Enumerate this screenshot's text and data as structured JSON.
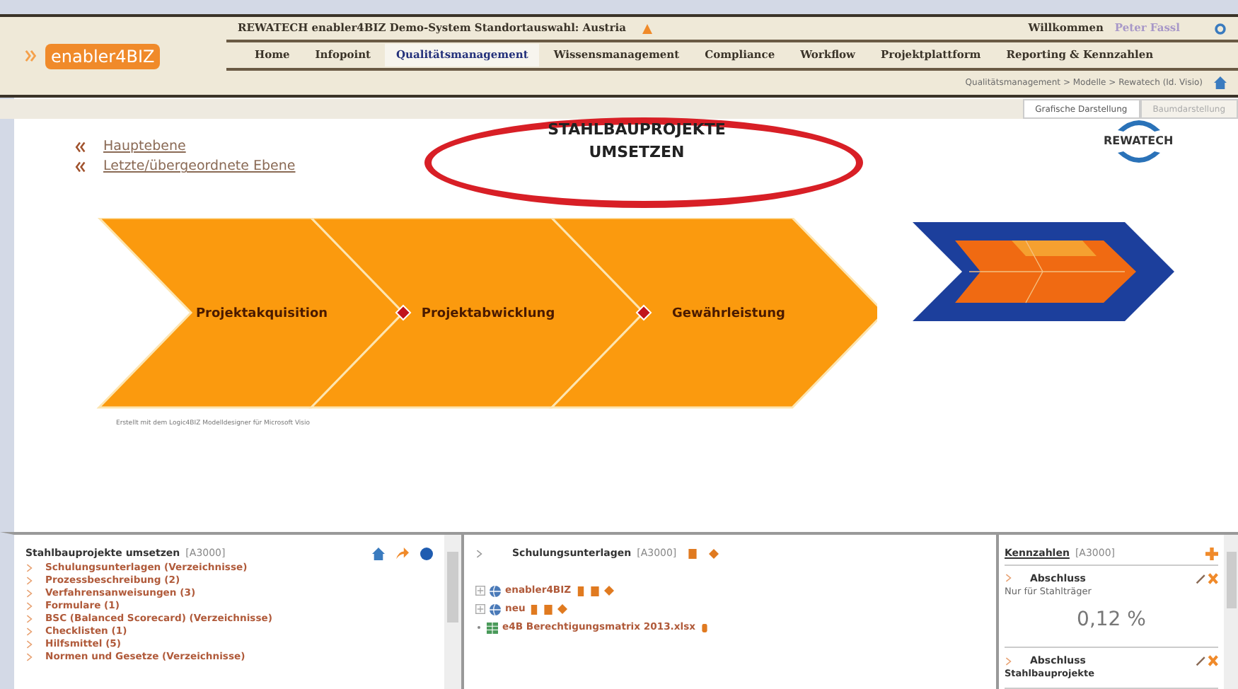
{
  "app_logo": "enabler4BIZ",
  "header": {
    "title": "REWATECH enabler4BIZ Demo-System Standortauswahl: Austria",
    "welcome": "Willkommen",
    "user": "Peter Fassl"
  },
  "nav": [
    {
      "label": "Home",
      "selected": false
    },
    {
      "label": "Infopoint",
      "selected": false
    },
    {
      "label": "Qualitätsmanagement",
      "selected": true
    },
    {
      "label": "Wissensmanagement",
      "selected": false
    },
    {
      "label": "Compliance",
      "selected": false
    },
    {
      "label": "Workflow",
      "selected": false
    },
    {
      "label": "Projektplattform",
      "selected": false
    },
    {
      "label": "Reporting & Kennzahlen",
      "selected": false
    }
  ],
  "breadcrumb": "Qualitätsmanagement > Modelle > Rewatech (Id. Visio)",
  "view_tabs": [
    {
      "label": "Grafische Darstellung",
      "selected": true
    },
    {
      "label": "Baumdarstellung",
      "selected": false
    }
  ],
  "back_links": [
    "Hauptebene",
    "Letzte/übergeordnete Ebene"
  ],
  "model_title": "STAHLBAUPROJEKTE UMSETZEN",
  "company_logo": "REWATECH",
  "process_steps": [
    "Projektakquisition",
    "Projektabwicklung",
    "Gewährleistung"
  ],
  "footnote": "Erstellt mit dem Logic4BIZ Modelldesigner für Microsoft Visio",
  "structure_panel": {
    "title": "Stahlbauprojekte umsetzen",
    "code": "[A3000]",
    "items": [
      "Schulungsunterlagen (Verzeichnisse)",
      "Prozessbeschreibung (2)",
      "Verfahrensanweisungen (3)",
      "Formulare (1)",
      "BSC (Balanced Scorecard) (Verzeichnisse)",
      "Checklisten (1)",
      "Hilfsmittel (5)",
      "Normen und Gesetze (Verzeichnisse)"
    ]
  },
  "documents_panel": {
    "title": "Schulungsunterlagen",
    "code": "[A3000]",
    "rows": [
      {
        "kind": "folder",
        "label": "enabler4BIZ"
      },
      {
        "kind": "folder",
        "label": "neu"
      },
      {
        "kind": "file",
        "label": "e4B Berechtigungsmatrix 2013.xlsx"
      }
    ]
  },
  "kpi_panel": {
    "title": "Kennzahlen",
    "code": "[A3000]",
    "cards": [
      {
        "name": "Abschluss",
        "description": "Nur für Stahlträger",
        "value": "0,12 %"
      },
      {
        "name": "Abschluss",
        "description": "Stahlbauprojekte"
      }
    ]
  }
}
